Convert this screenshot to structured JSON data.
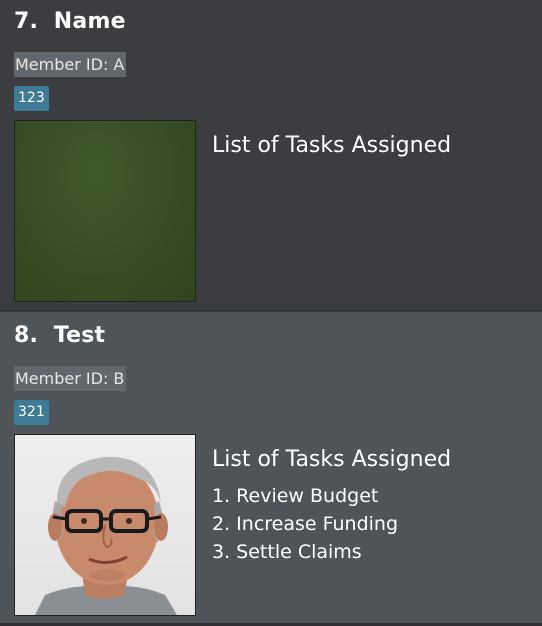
{
  "members": [
    {
      "index": "7.",
      "name": "Name",
      "member_id_label": "Member ID: A",
      "tag": "123",
      "photo_icon": "green-placeholder-image",
      "tasks_heading": "List of Tasks Assigned",
      "tasks": []
    },
    {
      "index": "8.",
      "name": "Test",
      "member_id_label": "Member ID: B",
      "tag": "321",
      "photo_icon": "person-photo",
      "tasks_heading": "List of Tasks Assigned",
      "tasks": [
        "1. Review Budget",
        "2. Increase Funding",
        "3. Settle Claims"
      ]
    }
  ],
  "colors": {
    "card_1_bg": "#3c3d41",
    "card_2_bg": "#4e5458",
    "member_id_bg": "#62666d",
    "tag_bg": "#3e7c95"
  }
}
